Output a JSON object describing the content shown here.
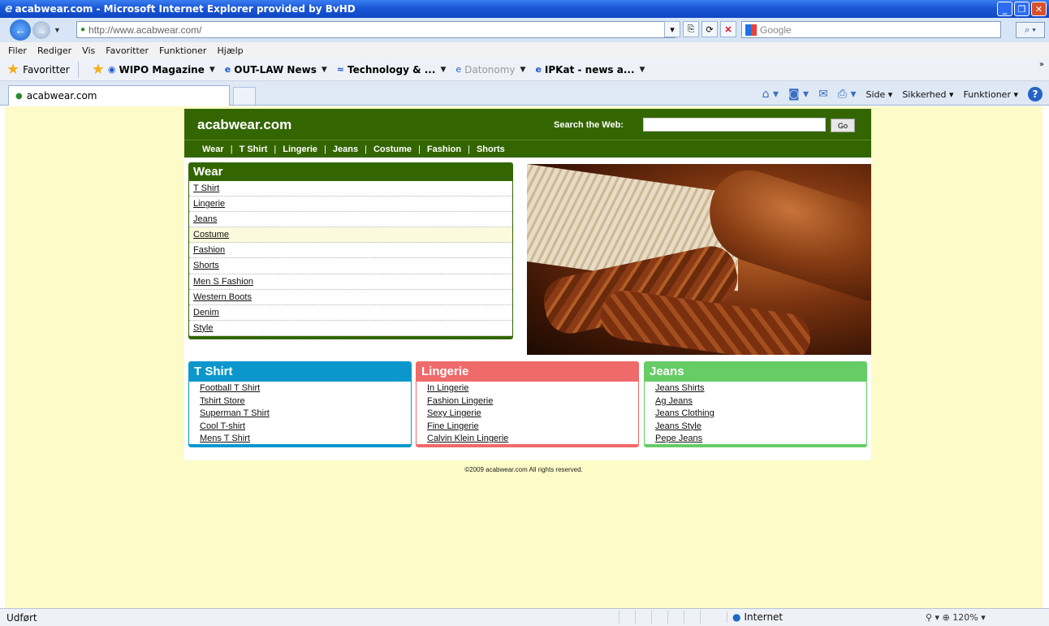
{
  "browser": {
    "title": "acabwear.com - Microsoft Internet Explorer provided by BvHD",
    "address": "http://www.acabwear.com/",
    "search_placeholder": "Google",
    "menu": [
      "Filer",
      "Rediger",
      "Vis",
      "Favoritter",
      "Funktioner",
      "Hjælp"
    ],
    "favorites_label": "Favoritter",
    "favorites": [
      {
        "label": "WIPO Magazine",
        "dim": false
      },
      {
        "label": "OUT-LAW News",
        "dim": false
      },
      {
        "label": "Technology & ...",
        "dim": false
      },
      {
        "label": "Datonomy",
        "dim": true
      },
      {
        "label": "IPKat - news a...",
        "dim": false
      }
    ],
    "tab_title": "acabwear.com",
    "commands": {
      "page": "Side",
      "safety": "Sikkerhed",
      "tools": "Funktioner"
    },
    "status_text": "Udført",
    "zone": "Internet",
    "zoom": "120%"
  },
  "site": {
    "logo": "acabwear.com",
    "search_label": "Search the Web:",
    "search_button": "Go",
    "nav": [
      "Wear",
      "T Shirt",
      "Lingerie",
      "Jeans",
      "Costume",
      "Fashion",
      "Shorts"
    ],
    "wear": {
      "title": "Wear",
      "items": [
        "T Shirt",
        "Lingerie",
        "Jeans",
        "Costume",
        "Fashion",
        "Shorts",
        "Men S Fashion",
        "Western Boots",
        "Denim",
        "Style"
      ]
    },
    "tshirt": {
      "title": "T Shirt",
      "items": [
        "Football T Shirt",
        "Tshirt Store",
        "Superman T Shirt",
        "Cool T-shirt",
        "Mens T Shirt"
      ]
    },
    "lingerie": {
      "title": "Lingerie",
      "items": [
        "In Lingerie",
        "Fashion Lingerie",
        "Sexy Lingerie",
        "Fine Lingerie",
        "Calvin Klein Lingerie"
      ]
    },
    "jeans": {
      "title": "Jeans",
      "items": [
        "Jeans Shirts",
        "Ag Jeans",
        "Jeans Clothing",
        "Jeans Style",
        "Pepe Jeans"
      ]
    },
    "copyright": "©2009 acabwear.com All rights reserved."
  },
  "colors": {
    "site_green": "#336600",
    "tshirt_blue": "#0b97cc",
    "lingerie_red": "#ef6a6a",
    "jeans_green": "#66cc66",
    "page_background": "#fdfbc8",
    "hover_highlight": "#fbfadd"
  }
}
